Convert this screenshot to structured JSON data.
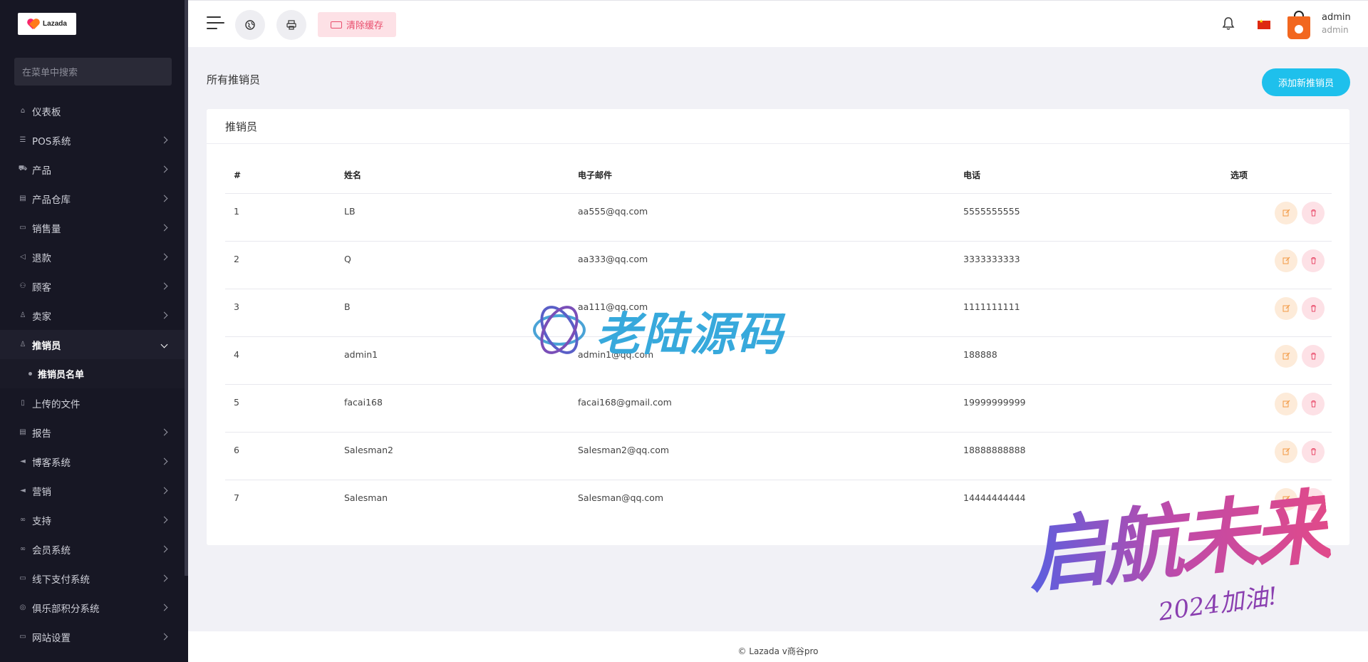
{
  "brand": {
    "logo_text": "Lazada"
  },
  "sidebar": {
    "search_placeholder": "在菜单中搜索",
    "items": [
      {
        "label": "仪表板",
        "icon": "home-icon",
        "has_children": false
      },
      {
        "label": "POS系统",
        "icon": "list-icon",
        "has_children": true
      },
      {
        "label": "产品",
        "icon": "cart-icon",
        "has_children": true
      },
      {
        "label": "产品仓库",
        "icon": "warehouse-icon",
        "has_children": true
      },
      {
        "label": "销售量",
        "icon": "sales-icon",
        "has_children": true
      },
      {
        "label": "退款",
        "icon": "refund-icon",
        "has_children": true
      },
      {
        "label": "顾客",
        "icon": "users-icon",
        "has_children": true
      },
      {
        "label": "卖家",
        "icon": "user-icon",
        "has_children": true
      },
      {
        "label": "推销员",
        "icon": "user-icon",
        "has_children": true,
        "active": true
      },
      {
        "label": "上传的文件",
        "icon": "file-icon",
        "has_children": false
      },
      {
        "label": "报告",
        "icon": "report-icon",
        "has_children": true
      },
      {
        "label": "博客系统",
        "icon": "megaphone-icon",
        "has_children": true
      },
      {
        "label": "营销",
        "icon": "megaphone-icon",
        "has_children": true
      },
      {
        "label": "支持",
        "icon": "link-icon",
        "has_children": true
      },
      {
        "label": "会员系统",
        "icon": "link-icon",
        "has_children": true
      },
      {
        "label": "线下支付系统",
        "icon": "cash-icon",
        "has_children": true
      },
      {
        "label": "俱乐部积分系统",
        "icon": "coin-icon",
        "has_children": true
      },
      {
        "label": "网站设置",
        "icon": "monitor-icon",
        "has_children": true
      }
    ],
    "submenu_active": "推销员名单"
  },
  "header": {
    "clear_cache_label": "清除缓存",
    "user_name": "admin",
    "user_role": "admin"
  },
  "page": {
    "title": "所有推销员",
    "add_button": "添加新推销员",
    "card_title": "推销员"
  },
  "table": {
    "headers": [
      "#",
      "姓名",
      "电子邮件",
      "电话",
      "选项"
    ],
    "rows": [
      {
        "num": "1",
        "name": "LB",
        "email": "aa555@qq.com",
        "phone": "5555555555"
      },
      {
        "num": "2",
        "name": "Q",
        "email": "aa333@qq.com",
        "phone": "3333333333"
      },
      {
        "num": "3",
        "name": "B",
        "email": "aa111@qq.com",
        "phone": "1111111111"
      },
      {
        "num": "4",
        "name": "admin1",
        "email": "admin1@qq.com",
        "phone": "188888"
      },
      {
        "num": "5",
        "name": "facai168",
        "email": "facai168@gmail.com",
        "phone": "19999999999"
      },
      {
        "num": "6",
        "name": "Salesman2",
        "email": "Salesman2@qq.com",
        "phone": "18888888888"
      },
      {
        "num": "7",
        "name": "Salesman",
        "email": "Salesman@qq.com",
        "phone": "14444444444"
      }
    ]
  },
  "footer": {
    "text": "© Lazada v商谷pro"
  },
  "watermarks": {
    "center": "老陆源码",
    "corner": "启航未来",
    "corner_sub": "2024加油!"
  },
  "colors": {
    "accent": "#1ec0ec",
    "sidebar_bg": "#171724",
    "danger": "#e94d6c",
    "warning": "#f29a44"
  }
}
